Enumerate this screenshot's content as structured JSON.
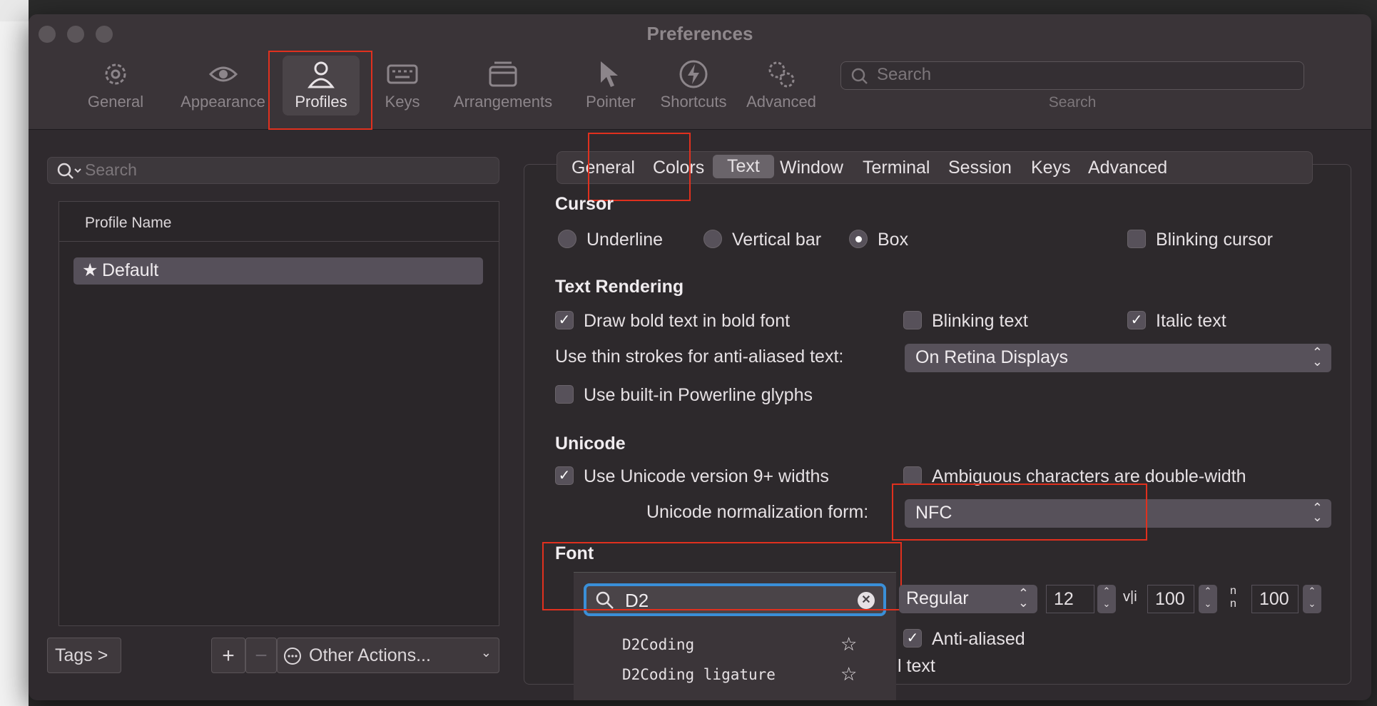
{
  "window": {
    "title": "Preferences"
  },
  "toolbar": {
    "items": [
      {
        "label": "General",
        "icon": "gear-icon"
      },
      {
        "label": "Appearance",
        "icon": "eye-icon"
      },
      {
        "label": "Profiles",
        "icon": "person-icon",
        "selected": true
      },
      {
        "label": "Keys",
        "icon": "keyboard-icon"
      },
      {
        "label": "Arrangements",
        "icon": "window-stack-icon"
      },
      {
        "label": "Pointer",
        "icon": "pointer-icon"
      },
      {
        "label": "Shortcuts",
        "icon": "bolt-icon"
      },
      {
        "label": "Advanced",
        "icon": "gears-icon"
      }
    ],
    "search_placeholder": "Search",
    "search_label": "Search"
  },
  "sidebar": {
    "search_placeholder": "Search",
    "column_header": "Profile Name",
    "profiles": [
      {
        "name": "Default",
        "icon": "star-icon"
      }
    ],
    "tags_button": "Tags >",
    "add_button": "+",
    "remove_button": "−",
    "other_actions": "Other Actions..."
  },
  "tabs": [
    "General",
    "Colors",
    "Text",
    "Window",
    "Terminal",
    "Session",
    "Keys",
    "Advanced"
  ],
  "selected_tab": "Text",
  "cursor": {
    "title": "Cursor",
    "options": [
      "Underline",
      "Vertical bar",
      "Box"
    ],
    "selected": "Box",
    "blinking": "Blinking cursor"
  },
  "rendering": {
    "title": "Text Rendering",
    "bold": "Draw bold text in bold font",
    "blinking_text": "Blinking text",
    "italic": "Italic text",
    "thin_label": "Use thin strokes for anti-aliased text:",
    "thin_value": "On Retina Displays",
    "powerline": "Use built-in Powerline glyphs"
  },
  "unicode": {
    "title": "Unicode",
    "v9": "Use Unicode version 9+ widths",
    "ambiguous": "Ambiguous characters are double-width",
    "norm_label": "Unicode normalization form:",
    "norm_value": "NFC"
  },
  "font": {
    "title": "Font",
    "search_value": "D2",
    "style": "Regular",
    "size": "12",
    "h_spacing": "100",
    "v_spacing": "100",
    "anti_aliased": "Anti-aliased",
    "partial_text": "l text",
    "results": [
      "D2Coding",
      "D2Coding ligature"
    ]
  },
  "colors": {
    "highlight": "#e0301e",
    "focus": "#3a8fd8"
  }
}
